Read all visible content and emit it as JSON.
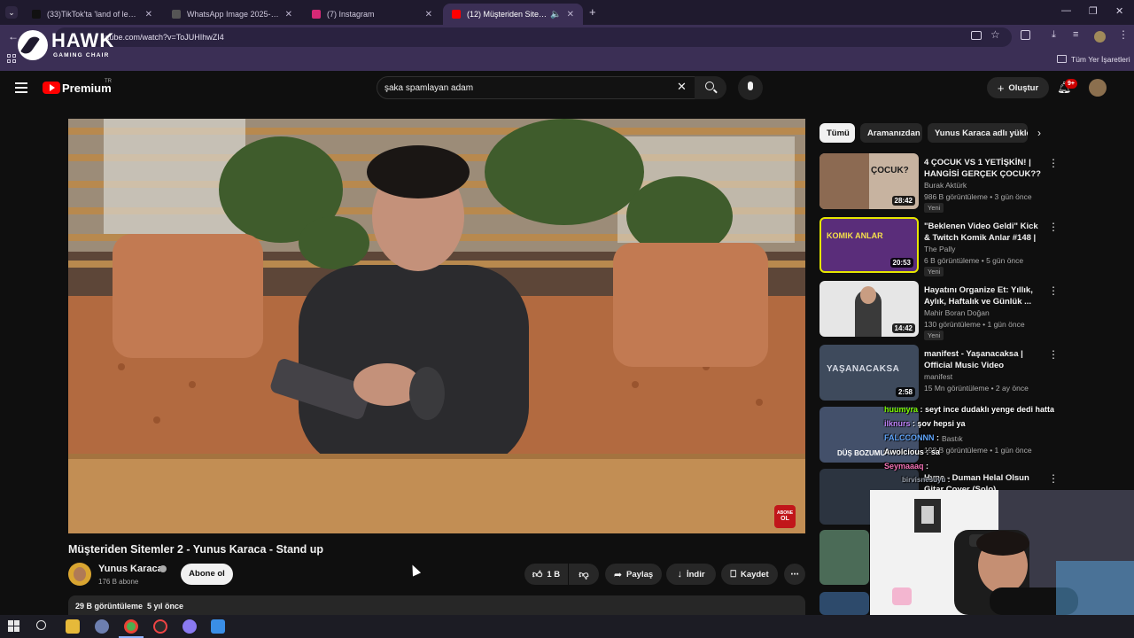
{
  "tabs": [
    {
      "title": "(33)TikTok'ta 'land of legends c",
      "favicon_color": "#111111"
    },
    {
      "title": "WhatsApp Image 2025-09-02 a",
      "favicon_color": "#444444"
    },
    {
      "title": "(7) Instagram",
      "favicon_color": "#d62976"
    },
    {
      "title": "(12) Müşteriden Sitemler 2",
      "favicon_color": "#ff0000"
    }
  ],
  "address_bar": {
    "url": "utube.com/watch?v=ToJUHIhwZI4"
  },
  "bookmarks": {
    "all_bookmarks": "Tüm Yer İşaretleri"
  },
  "overlay_logo": {
    "brand": "HAWK",
    "tagline": "GAMING CHAIR"
  },
  "youtube": {
    "logo_text": "Premium",
    "region": "TR",
    "search_value": "şaka spamlayan adam",
    "create_label": "Oluştur",
    "notification_count": "9+"
  },
  "video": {
    "title": "Müşteriden Sitemler 2 - Yunus Karaca - Stand up",
    "channel": "Yunus Karaca",
    "subscribers": "176 B abone",
    "subscribe_label": "Abone ol",
    "likes": "1 B",
    "share_label": "Paylaş",
    "download_label": "İndir",
    "save_label": "Kaydet",
    "views_date": "29 B görüntüleme  5 yıl önce",
    "watermark_line1": "ABONE",
    "watermark_line2": "OL"
  },
  "chips": [
    "Tümü",
    "Aramanızdan",
    "Yunus Karaca adlı yükle"
  ],
  "recommendations": [
    {
      "title": "4 ÇOCUK VS 1 YETİŞKİN! | HANGİSİ GERÇEK ÇOCUK?? ...",
      "channel": "Burak Aktürk",
      "meta": "986 B görüntüleme • 3 gün önce",
      "badge": "Yeni",
      "duration": "28:42",
      "thumb_text": "ÇOCUK?",
      "thumb_color": "#c7b3a0"
    },
    {
      "title": "\"Beklenen Video Geldi\" Kick & Twitch Komik Anlar #148 | Th...",
      "channel": "The Pally",
      "meta": "6 B görüntüleme • 5 gün önce",
      "badge": "Yeni",
      "duration": "20:53",
      "thumb_text": "KOMIK ANLAR",
      "thumb_color": "#5a2d7a"
    },
    {
      "title": "Hayatını Organize Et: Yıllık, Aylık, Haftalık ve Günlük ...",
      "channel": "Mahir Boran Doğan",
      "meta": "130 görüntüleme • 1 gün önce",
      "badge": "Yeni",
      "duration": "14:42",
      "thumb_text": "",
      "thumb_color": "#e6e6e6"
    },
    {
      "title": "manifest - Yaşanacaksa | Official Music Video",
      "channel": "manifest",
      "meta": "15 Mn görüntüleme • 2 ay önce",
      "badge": "",
      "duration": "2:58",
      "thumb_text": "YAŞANACAKSA",
      "thumb_color": "#3e4a5c"
    },
    {
      "title": "",
      "channel": "Bastık",
      "meta": "198 B görüntüleme • 1 gün önce",
      "badge": "",
      "duration": "",
      "thumb_text": "DÜŞ BOZUMU",
      "thumb_color": "#43506a"
    },
    {
      "title": "Hype - Duman Helal Olsun Gitar Cover (Solo)",
      "channel": "",
      "meta": "",
      "badge": "",
      "duration": "",
      "thumb_text": "",
      "thumb_color": "#2c3440"
    }
  ],
  "chat": [
    {
      "user": "huumyra",
      "text": "seyt ince dudaklı yenge dedi hatta",
      "color": "#7cfc00"
    },
    {
      "user": "ilknurs",
      "text": "şov hepsi ya",
      "color": "#c084fc"
    },
    {
      "user": "FALCCONNN",
      "text": "",
      "color": "#60a5fa"
    },
    {
      "user": "Awolcious",
      "text": "sa",
      "color": "#ffffff"
    },
    {
      "user": "Seymaaaq",
      "text": "",
      "color": "#f472b6"
    },
    {
      "user": "birvisnesuyu",
      "text": "",
      "color": "#9ca3af"
    }
  ],
  "colors": {
    "accent": "#ff0000",
    "bg": "#0f0f0f",
    "tabbar": "#1f1a2e",
    "toolbar": "#3b2f55"
  }
}
